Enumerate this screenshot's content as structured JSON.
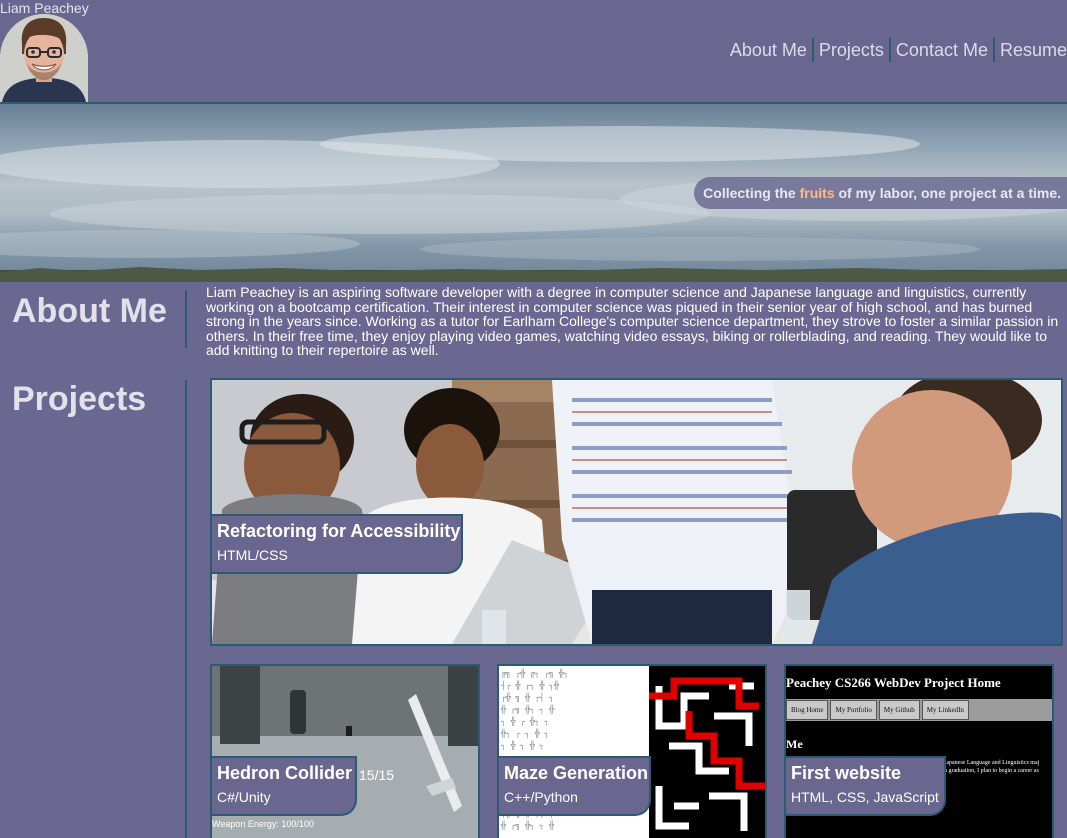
{
  "header": {
    "site_name": "Liam Peachey",
    "nav": [
      {
        "label": "About Me"
      },
      {
        "label": "Projects"
      },
      {
        "label": "Contact Me"
      },
      {
        "label": "Resume"
      }
    ]
  },
  "hero": {
    "tagline_before": "Collecting the ",
    "tagline_accent": "fruits",
    "tagline_after": " of my labor, one project at a time."
  },
  "about": {
    "title": "About Me",
    "text": "Liam Peachey is an aspiring software developer with a degree in computer science and Japanese language and linguistics, currently working on a bootcamp certification. Their interest in computer science was piqued in their senior year of high school, and has burned strong in the years since. Working as a tutor for Earlham College's computer science department, they strove to foster a similar passion in others. In their free time, they enjoy playing video games, watching video essays, biking or rollerblading, and reading. They would like to add knitting to their repertoire as well."
  },
  "projects": {
    "title": "Projects",
    "items": [
      {
        "title": "Refactoring for Accessibility",
        "tech": "HTML/CSS"
      },
      {
        "title": "Hedron Collider",
        "tech": "C#/Unity",
        "screen_counter": "15/15",
        "screen_energy": "Weapon Energy: 100/100"
      },
      {
        "title": "Maze Generation",
        "tech": "C++/Python"
      },
      {
        "title": "First website",
        "tech": "HTML, CSS, JavaScript",
        "screen_heading": "Peachey CS266 WebDev Project Home",
        "screen_tabs": [
          "Blog Home",
          "My Portfolio",
          "My Github",
          "My LinkedIn"
        ],
        "screen_me": "Me",
        "screen_text_1": "Japanese Language and Linguistics maj",
        "screen_text_2": "n graduation, I plan to begin a career as"
      }
    ]
  },
  "colors": {
    "background": "#6a6790",
    "border_accent": "#2d5a73",
    "tagline_highlight": "#ffb987"
  }
}
